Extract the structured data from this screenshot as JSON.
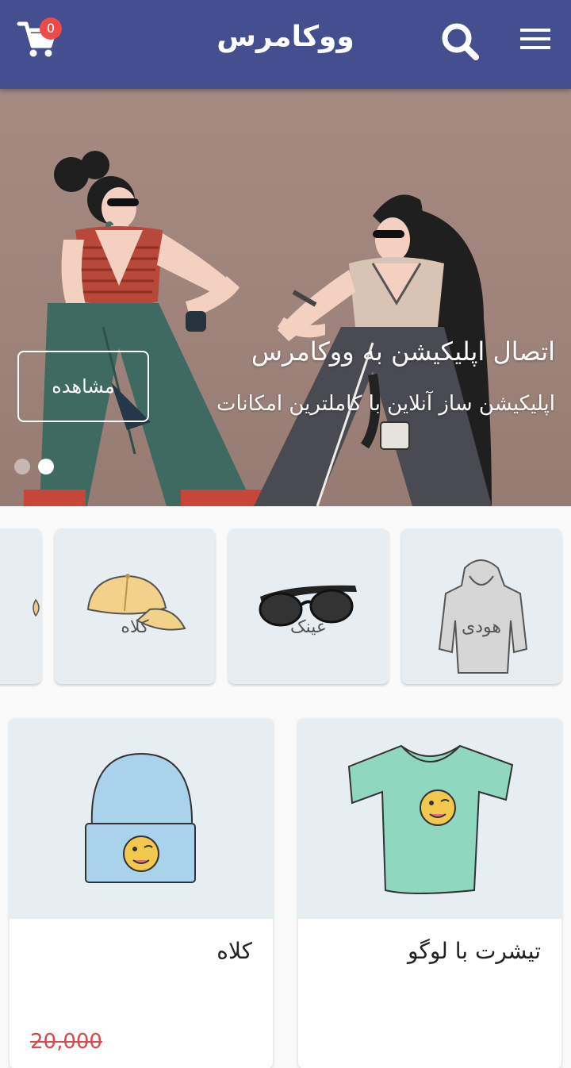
{
  "app": {
    "title": "ووکامرس",
    "cart_count": "0"
  },
  "icons": {
    "cart": "shopping-cart-icon",
    "search": "search-icon",
    "menu": "hamburger-menu-icon"
  },
  "colors": {
    "appbar": "#434f8e",
    "badge": "#ef4a4a",
    "price_old": "#d54c4c"
  },
  "hero": {
    "title": "اتصال اپلیکیشن به ووکامرس",
    "subtitle": "اپلیکیشن ساز آنلاین با کاملترین امکانات",
    "button_label": "مشاهده",
    "slides_count": 2,
    "active_slide": 2
  },
  "categories": [
    {
      "label": "هودی",
      "icon": "hoodie-icon"
    },
    {
      "label": "عینک",
      "icon": "sunglasses-icon"
    },
    {
      "label": "کلاه",
      "icon": "cap-icon"
    }
  ],
  "products": [
    {
      "name": "تیشرت با لوگو",
      "icon": "tshirt-icon"
    },
    {
      "name": "کلاه",
      "icon": "beanie-icon",
      "price_old": "20,000"
    }
  ]
}
